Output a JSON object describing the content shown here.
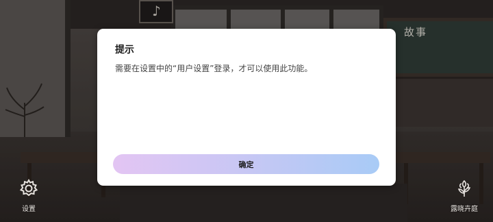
{
  "dialog": {
    "title": "提示",
    "message": "需要在设置中的“用户设置”登录，才可以使用此功能。",
    "confirm_label": "确定"
  },
  "corner": {
    "settings_label": "设置",
    "settings_icon": "gear-icon",
    "garden_label": "露晓卉庭",
    "garden_icon": "flower-icon"
  },
  "background": {
    "board_text": "故事"
  },
  "colors": {
    "dialog_bg": "#ffffff",
    "button_gradient_start": "#e3c5f3",
    "button_gradient_end": "#a8cbf6",
    "corner_label": "#e8e4e0"
  }
}
